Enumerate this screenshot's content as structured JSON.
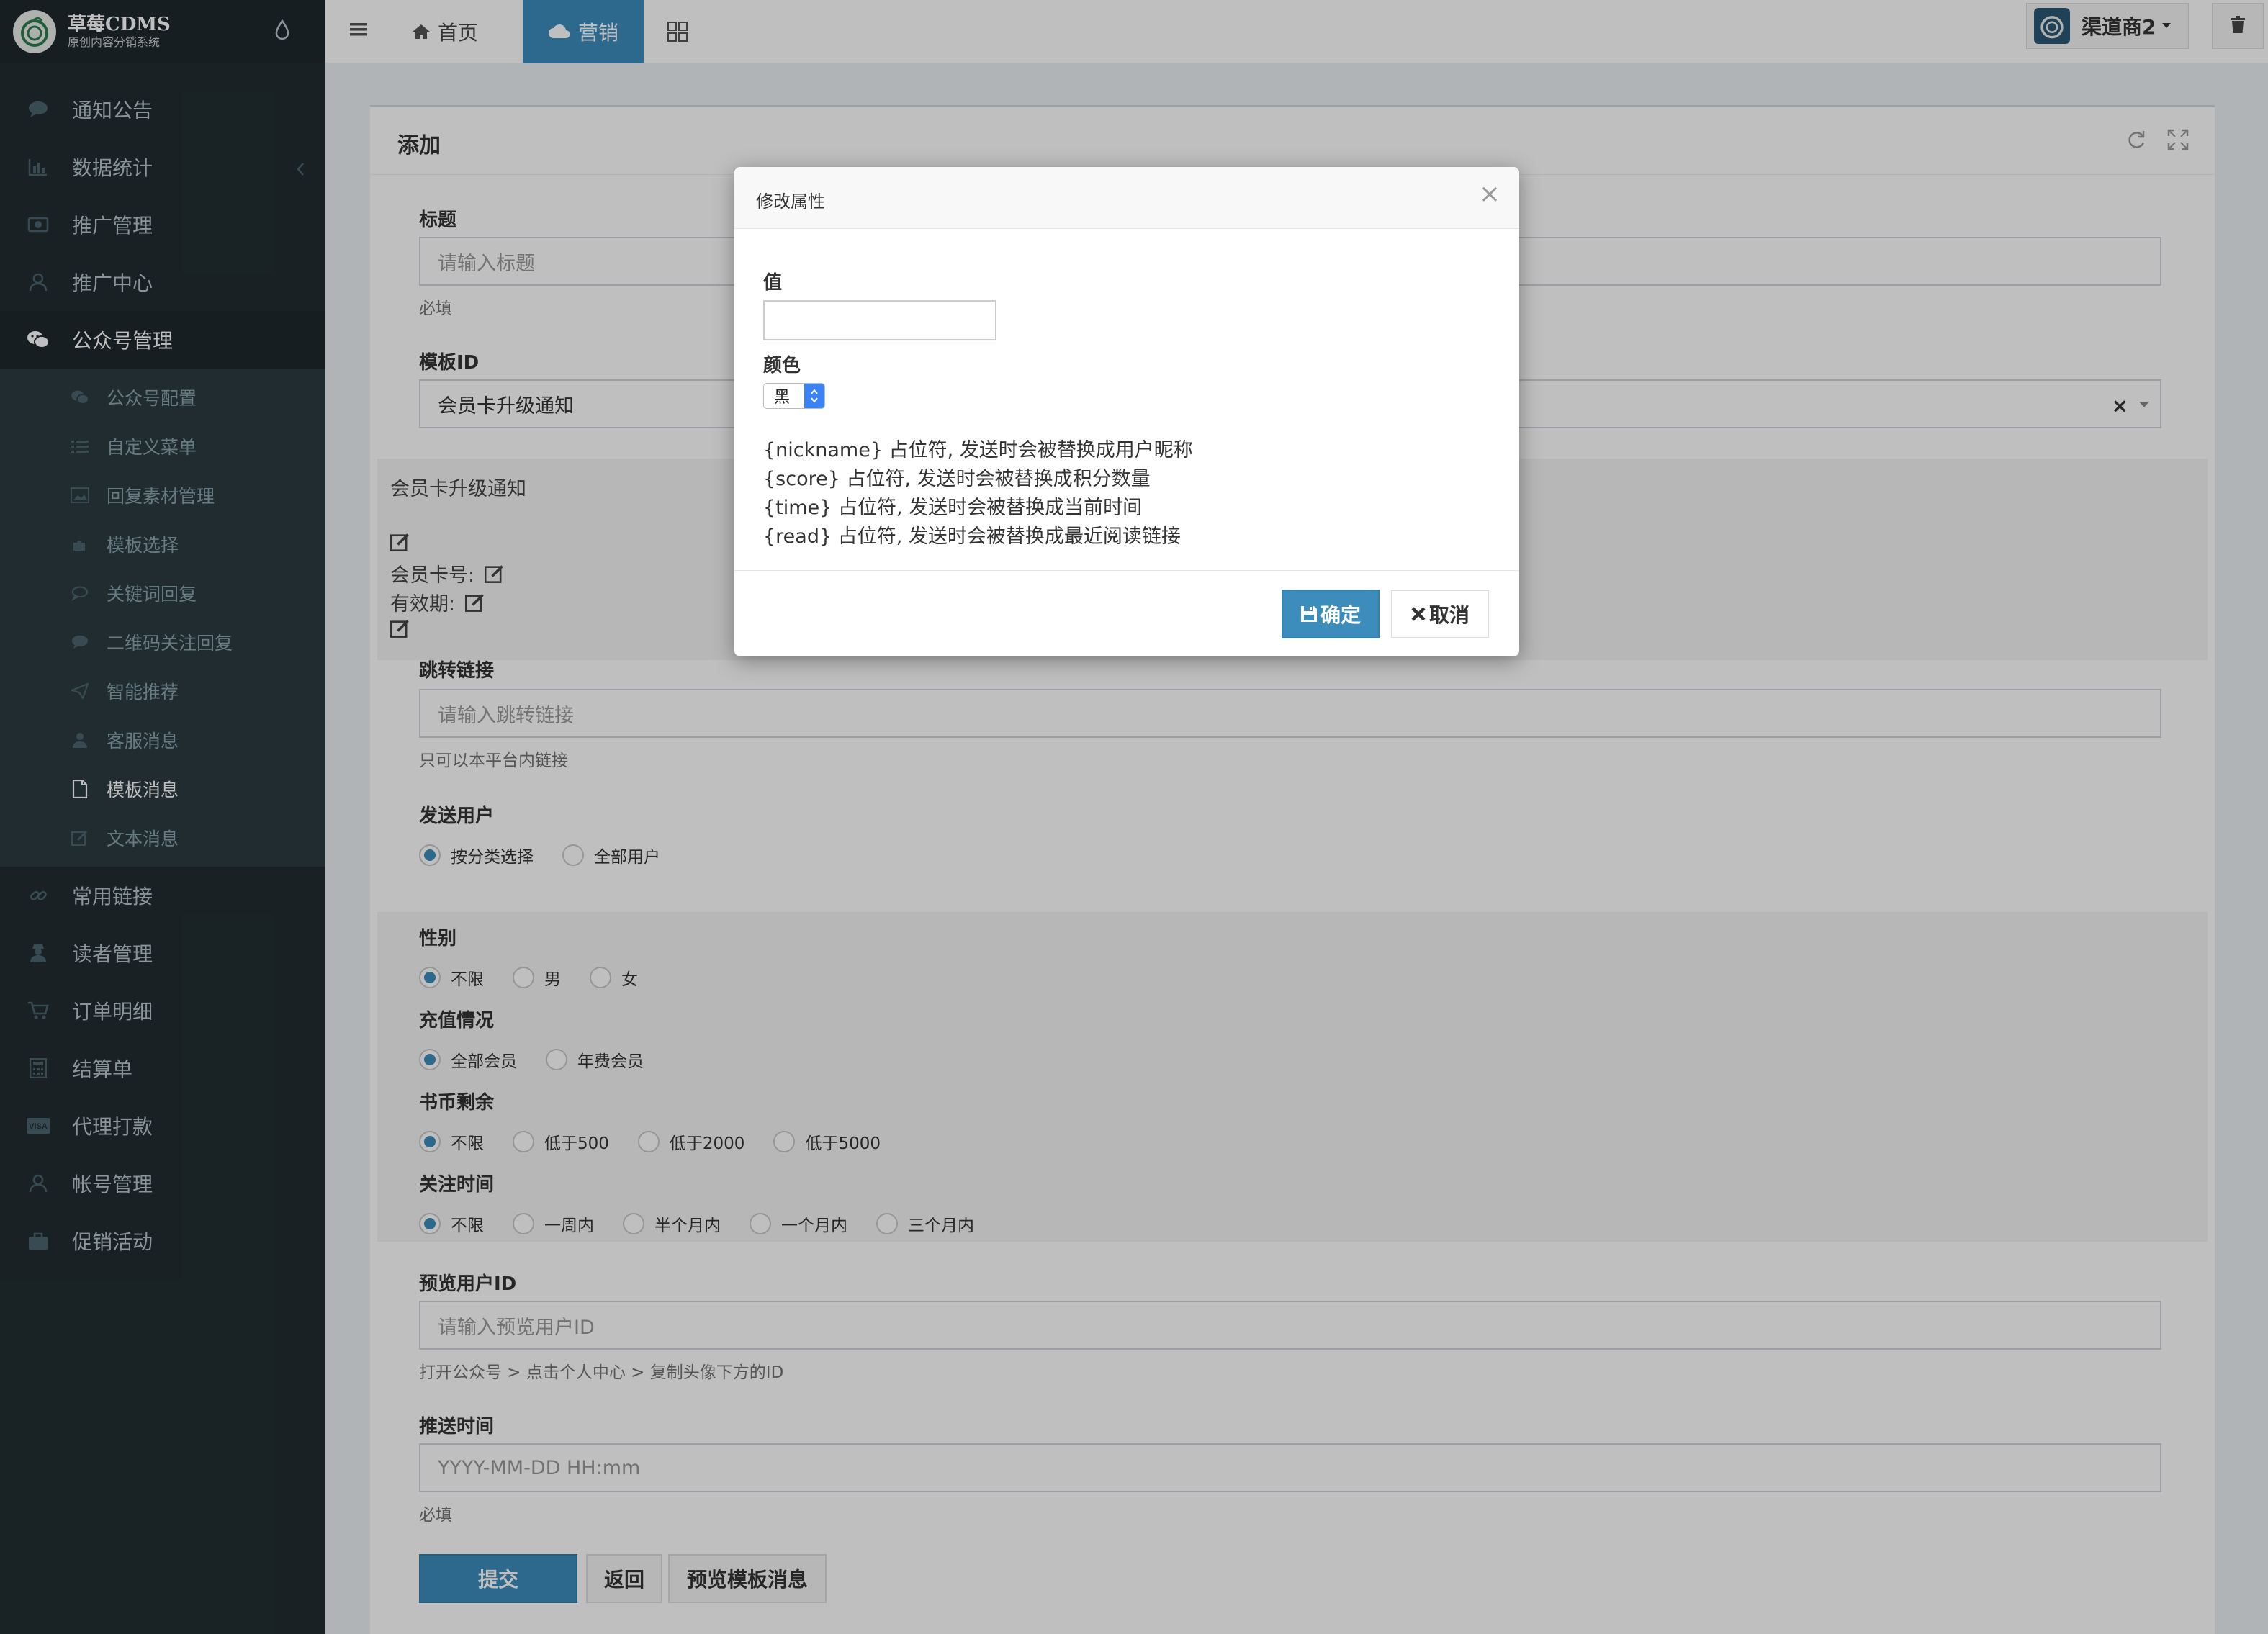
{
  "app": {
    "logo_title": "草莓CDMS",
    "logo_subtitle": "原创内容分销系统"
  },
  "sidebar": {
    "items": [
      {
        "label": "通知公告",
        "icon": "comment-icon"
      },
      {
        "label": "数据统计",
        "icon": "bar-chart-icon"
      },
      {
        "label": "推广管理",
        "icon": "money-icon"
      },
      {
        "label": "推广中心",
        "icon": "user-icon"
      },
      {
        "label": "公众号管理",
        "icon": "wechat-icon"
      }
    ],
    "sub_items": [
      {
        "label": "公众号配置",
        "icon": "wechat-icon"
      },
      {
        "label": "自定义菜单",
        "icon": "list-icon"
      },
      {
        "label": "回复素材管理",
        "icon": "image-icon"
      },
      {
        "label": "模板选择",
        "icon": "puzzle-icon"
      },
      {
        "label": "关键词回复",
        "icon": "comment-icon"
      },
      {
        "label": "二维码关注回复",
        "icon": "comment-icon"
      },
      {
        "label": "智能推荐",
        "icon": "send-icon"
      },
      {
        "label": "客服消息",
        "icon": "user-icon"
      },
      {
        "label": "模板消息",
        "icon": "file-icon"
      },
      {
        "label": "文本消息",
        "icon": "edit-icon"
      }
    ],
    "bottom_items": [
      {
        "label": "常用链接",
        "icon": "link-icon"
      },
      {
        "label": "读者管理",
        "icon": "user-secret-icon"
      },
      {
        "label": "订单明细",
        "icon": "cart-icon"
      },
      {
        "label": "结算单",
        "icon": "calculator-icon"
      },
      {
        "label": "代理打款",
        "icon": "visa-icon"
      },
      {
        "label": "帐号管理",
        "icon": "user-icon"
      },
      {
        "label": "促销活动",
        "icon": "briefcase-icon"
      }
    ]
  },
  "navbar": {
    "home_label": "首页",
    "marketing_label": "营销",
    "user_name": "渠道商2"
  },
  "form": {
    "header_title": "添加",
    "title_label": "标题",
    "title_placeholder": "请输入标题",
    "title_help": "必填",
    "template_label": "模板ID",
    "template_value": "会员卡升级通知",
    "preview_title": "会员卡升级通知",
    "preview_card_no": "会员卡号:",
    "preview_valid": "有效期:",
    "link_label": "跳转链接",
    "link_placeholder": "请输入跳转链接",
    "link_help": "只可以本平台内链接",
    "send_user_label": "发送用户",
    "send_user_options": [
      "按分类选择",
      "全部用户"
    ],
    "gender_label": "性别",
    "gender_options": [
      "不限",
      "男",
      "女"
    ],
    "recharge_label": "充值情况",
    "recharge_options": [
      "全部会员",
      "年费会员"
    ],
    "coin_label": "书币剩余",
    "coin_options": [
      "不限",
      "低于500",
      "低于2000",
      "低于5000"
    ],
    "follow_label": "关注时间",
    "follow_options": [
      "不限",
      "一周内",
      "半个月内",
      "一个月内",
      "三个月内"
    ],
    "preview_uid_label": "预览用户ID",
    "preview_uid_placeholder": "请输入预览用户ID",
    "preview_uid_help": "打开公众号 > 点击个人中心 > 复制头像下方的ID",
    "push_time_label": "推送时间",
    "push_time_placeholder": "YYYY-MM-DD HH:mm",
    "push_time_help": "必填",
    "submit_label": "提交",
    "back_label": "返回",
    "preview_btn_label": "预览模板消息"
  },
  "modal": {
    "title": "修改属性",
    "value_label": "值",
    "value_input": "",
    "color_label": "颜色",
    "color_value": "黑",
    "tips": [
      "{nickname} 占位符, 发送时会被替换成用户昵称",
      "{score} 占位符, 发送时会被替换成积分数量",
      "{time} 占位符, 发送时会被替换成当前时间",
      "{read} 占位符, 发送时会被替换成最近阅读链接"
    ],
    "ok_label": "确定",
    "cancel_label": "取消"
  },
  "colors": {
    "sidebar_bg": "#222d32",
    "accent": "#3c8dbc",
    "content_bg": "#ecf0f5"
  }
}
